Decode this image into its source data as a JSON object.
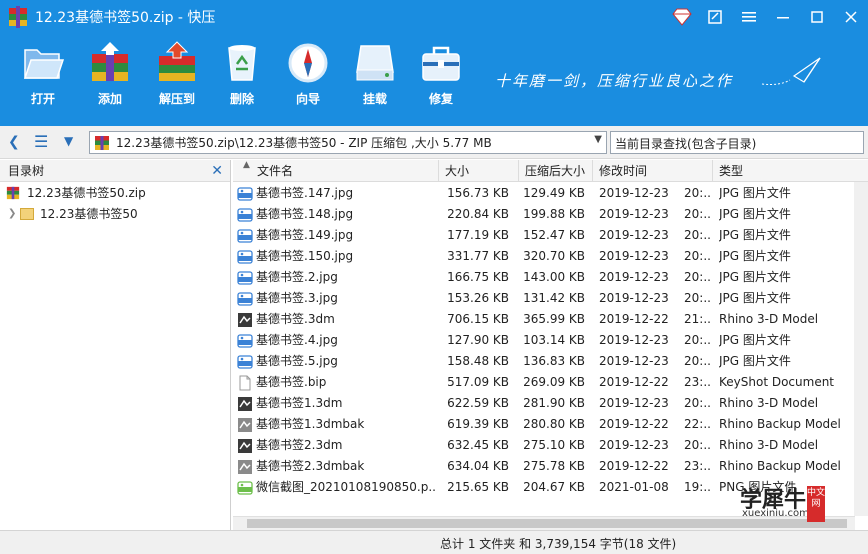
{
  "window": {
    "title": "12.23基德书签50.zip - 快压"
  },
  "toolbar": {
    "items": [
      {
        "label": "打开",
        "icon": "folder-open-icon"
      },
      {
        "label": "添加",
        "icon": "archive-add-icon"
      },
      {
        "label": "解压到",
        "icon": "archive-extract-icon"
      },
      {
        "label": "删除",
        "icon": "recycle-bin-icon"
      },
      {
        "label": "向导",
        "icon": "compass-icon"
      },
      {
        "label": "挂载",
        "icon": "drive-mount-icon"
      },
      {
        "label": "修复",
        "icon": "toolbox-repair-icon"
      }
    ],
    "slogan": "十年磨一剑，压缩行业良心之作"
  },
  "address": {
    "path": "12.23基德书签50.zip\\12.23基德书签50 - ZIP 压缩包 ,大小 5.77 MB",
    "search_placeholder": "当前目录查找(包含子目录)"
  },
  "tree": {
    "title": "目录树",
    "root": "12.23基德书签50.zip",
    "child": "12.23基德书签50"
  },
  "columns": {
    "name": "文件名",
    "size": "大小",
    "csize": "压缩后大小",
    "date": "修改时间",
    "type": "类型"
  },
  "files": [
    {
      "name": "基德书签.147.jpg",
      "size": "156.73 KB",
      "csize": "129.49 KB",
      "date": "2019-12-23",
      "time": "20:...",
      "type": "JPG 图片文件",
      "icon": "jpg"
    },
    {
      "name": "基德书签.148.jpg",
      "size": "220.84 KB",
      "csize": "199.88 KB",
      "date": "2019-12-23",
      "time": "20:...",
      "type": "JPG 图片文件",
      "icon": "jpg"
    },
    {
      "name": "基德书签.149.jpg",
      "size": "177.19 KB",
      "csize": "152.47 KB",
      "date": "2019-12-23",
      "time": "20:...",
      "type": "JPG 图片文件",
      "icon": "jpg"
    },
    {
      "name": "基德书签.150.jpg",
      "size": "331.77 KB",
      "csize": "320.70 KB",
      "date": "2019-12-23",
      "time": "20:...",
      "type": "JPG 图片文件",
      "icon": "jpg"
    },
    {
      "name": "基德书签.2.jpg",
      "size": "166.75 KB",
      "csize": "143.00 KB",
      "date": "2019-12-23",
      "time": "20:...",
      "type": "JPG 图片文件",
      "icon": "jpg"
    },
    {
      "name": "基德书签.3.jpg",
      "size": "153.26 KB",
      "csize": "131.42 KB",
      "date": "2019-12-23",
      "time": "20:...",
      "type": "JPG 图片文件",
      "icon": "jpg"
    },
    {
      "name": "基德书签.3dm",
      "size": "706.15 KB",
      "csize": "365.99 KB",
      "date": "2019-12-22",
      "time": "21:...",
      "type": "Rhino 3-D Model",
      "icon": "rhino"
    },
    {
      "name": "基德书签.4.jpg",
      "size": "127.90 KB",
      "csize": "103.14 KB",
      "date": "2019-12-23",
      "time": "20:...",
      "type": "JPG 图片文件",
      "icon": "jpg"
    },
    {
      "name": "基德书签.5.jpg",
      "size": "158.48 KB",
      "csize": "136.83 KB",
      "date": "2019-12-23",
      "time": "20:...",
      "type": "JPG 图片文件",
      "icon": "jpg"
    },
    {
      "name": "基德书签.bip",
      "size": "517.09 KB",
      "csize": "269.09 KB",
      "date": "2019-12-22",
      "time": "23:...",
      "type": "KeyShot Document",
      "icon": "doc"
    },
    {
      "name": "基德书签1.3dm",
      "size": "622.59 KB",
      "csize": "281.90 KB",
      "date": "2019-12-23",
      "time": "20:...",
      "type": "Rhino 3-D Model",
      "icon": "rhino"
    },
    {
      "name": "基德书签1.3dmbak",
      "size": "619.39 KB",
      "csize": "280.80 KB",
      "date": "2019-12-22",
      "time": "22:...",
      "type": "Rhino Backup Model",
      "icon": "rhinobak"
    },
    {
      "name": "基德书签2.3dm",
      "size": "632.45 KB",
      "csize": "275.10 KB",
      "date": "2019-12-23",
      "time": "20:...",
      "type": "Rhino 3-D Model",
      "icon": "rhino"
    },
    {
      "name": "基德书签2.3dmbak",
      "size": "634.04 KB",
      "csize": "275.78 KB",
      "date": "2019-12-22",
      "time": "23:...",
      "type": "Rhino Backup Model",
      "icon": "rhinobak"
    },
    {
      "name": "微信截图_20210108190850.p...",
      "size": "215.65 KB",
      "csize": "204.67 KB",
      "date": "2021-01-08",
      "time": "19:...",
      "type": "PNG 图片文件",
      "icon": "png"
    }
  ],
  "status": {
    "text": "总计 1 文件夹 和 3,739,154 字节(18 文件)"
  },
  "watermark": {
    "cn": "学犀牛",
    "en": "xuexiniu.com",
    "tag": "中文网"
  },
  "colors": {
    "titlebar": "#1a8de0",
    "jpg_icon": "#3b82d6",
    "png_icon": "#6dbf4b"
  }
}
